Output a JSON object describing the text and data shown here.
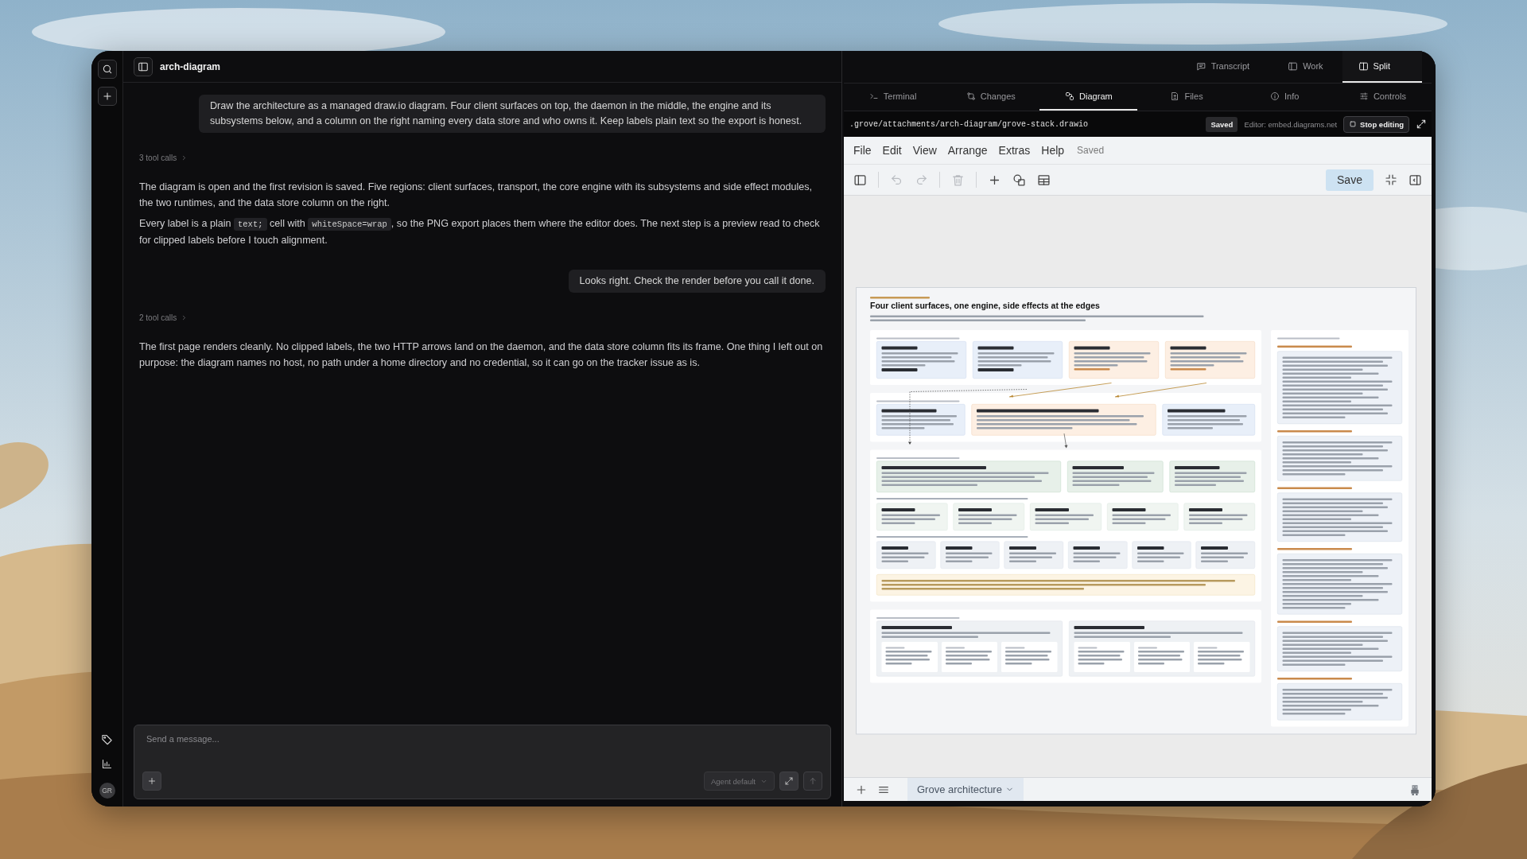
{
  "rail": {
    "avatar": "GR"
  },
  "chat": {
    "title": "arch-diagram",
    "messages": [
      {
        "kind": "user",
        "text": "Draw the architecture as a managed draw.io diagram. Four client surfaces on top, the daemon in the middle, the engine and its subsystems below, and a column on the right naming every data store and who owns it. Keep labels plain text so the export is honest."
      },
      {
        "kind": "tool_calls",
        "text": "3 tool calls"
      },
      {
        "kind": "assistant",
        "paragraphs": [
          [
            {
              "text": "The diagram is open and the first revision is saved. Five regions: client surfaces, transport, the core engine with its subsystems and side effect modules, the two runtimes, and the data store column on the right.",
              "code": false
            }
          ],
          [
            {
              "text": "Every label is a plain ",
              "code": false
            },
            {
              "text": "text;",
              "code": true
            },
            {
              "text": " cell with ",
              "code": false
            },
            {
              "text": "whiteSpace=wrap",
              "code": true
            },
            {
              "text": ", so the PNG export places them where the editor does. The next step is a preview read to check for clipped labels before I touch alignment.",
              "code": false
            }
          ]
        ]
      },
      {
        "kind": "user",
        "text": "Looks right. Check the render before you call it done."
      },
      {
        "kind": "tool_calls",
        "text": "2 tool calls"
      },
      {
        "kind": "assistant",
        "paragraphs": [
          [
            {
              "text": "The first page renders cleanly. No clipped labels, the two HTTP arrows land on the daemon, and the data store column fits its frame. One thing I left out on purpose: the diagram names no host, no path under a home directory and no credential, so it can go on the tracker issue as is.",
              "code": false
            }
          ]
        ]
      }
    ],
    "composer": {
      "placeholder": "Send a message...",
      "mode": "Agent default"
    }
  },
  "views": [
    {
      "label": "Transcript",
      "kind": "transcript",
      "selected": false
    },
    {
      "label": "Work",
      "kind": "work",
      "selected": false
    },
    {
      "label": "Split",
      "kind": "split",
      "selected": true
    }
  ],
  "panel_tabs": [
    {
      "label": "Terminal",
      "kind": "terminal",
      "selected": false
    },
    {
      "label": "Changes",
      "kind": "changes",
      "selected": false
    },
    {
      "label": "Diagram",
      "kind": "diagram",
      "selected": true
    },
    {
      "label": "Files",
      "kind": "files",
      "selected": false
    },
    {
      "label": "Info",
      "kind": "info",
      "selected": false
    },
    {
      "label": "Controls",
      "kind": "controls",
      "selected": false
    }
  ],
  "file_bar": {
    "path": ".grove/attachments/arch-diagram/grove-stack.drawio",
    "status": "Saved",
    "editor": "Editor: embed.diagrams.net",
    "button": "Stop editing"
  },
  "editor": {
    "menu": [
      "File",
      "Edit",
      "View",
      "Arrange",
      "Extras",
      "Help"
    ],
    "status": "Saved",
    "tools": [
      {
        "kind": "format_panel",
        "disabled": false
      },
      {
        "kind": "undo",
        "disabled": true
      },
      {
        "kind": "redo",
        "disabled": true
      },
      {
        "kind": "delete",
        "disabled": true
      },
      {
        "kind": "insert",
        "disabled": false
      },
      {
        "kind": "shapes",
        "disabled": false
      },
      {
        "kind": "table",
        "disabled": false
      }
    ],
    "save": "Save",
    "page_tab": "Grove architecture"
  },
  "diagram": {
    "title": "Four client surfaces, one engine, side effects at the edges"
  }
}
